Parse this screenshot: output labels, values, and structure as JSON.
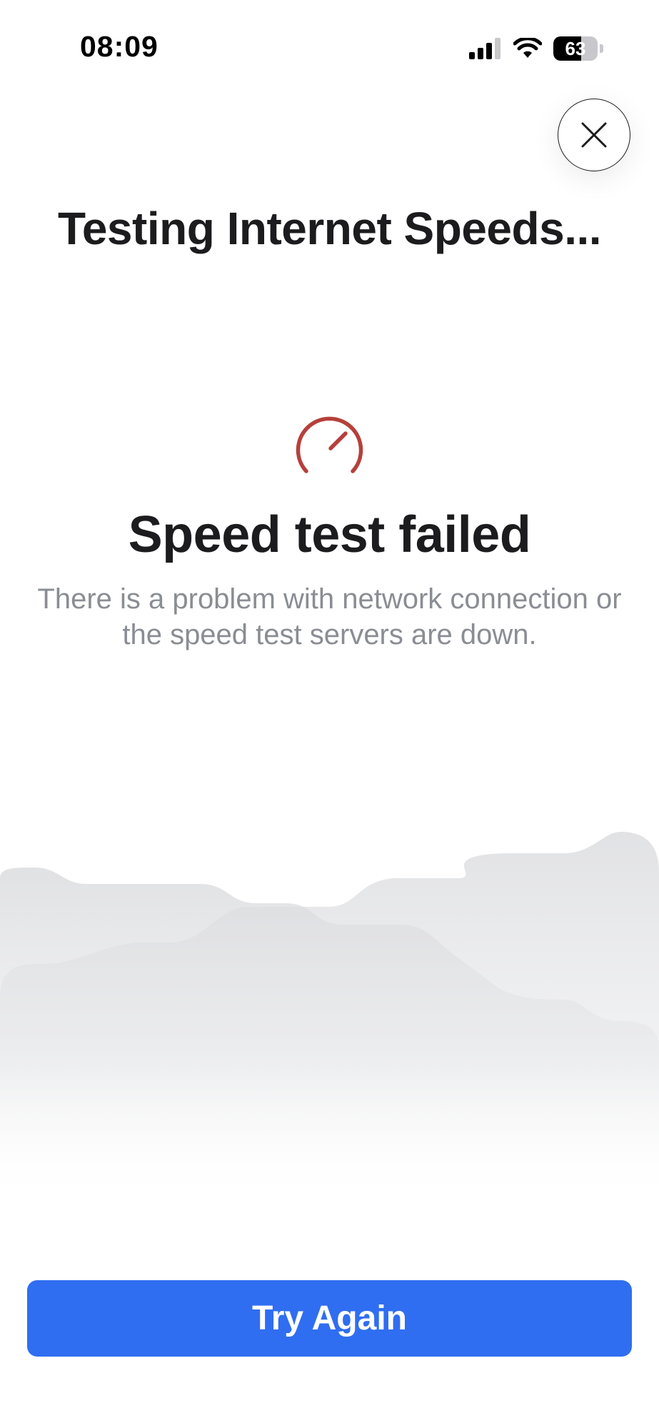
{
  "status_bar": {
    "time": "08:09",
    "battery_percent": "63",
    "battery_level": 0.63,
    "icons": [
      "signal-icon",
      "wifi-icon",
      "battery-icon"
    ]
  },
  "header": {
    "close_icon": "close-icon",
    "title": "Testing Internet Speeds..."
  },
  "result": {
    "icon": "speedometer-icon",
    "title": "Speed test failed",
    "message": "There is a problem with network connection or the speed test servers are down."
  },
  "actions": {
    "try_again_label": "Try Again"
  },
  "colors": {
    "accent": "#2f6ef0",
    "error_icon": "#b5403b",
    "title_text": "#1c1c1e",
    "message_text": "#8a8d93",
    "background": "#ffffff"
  }
}
